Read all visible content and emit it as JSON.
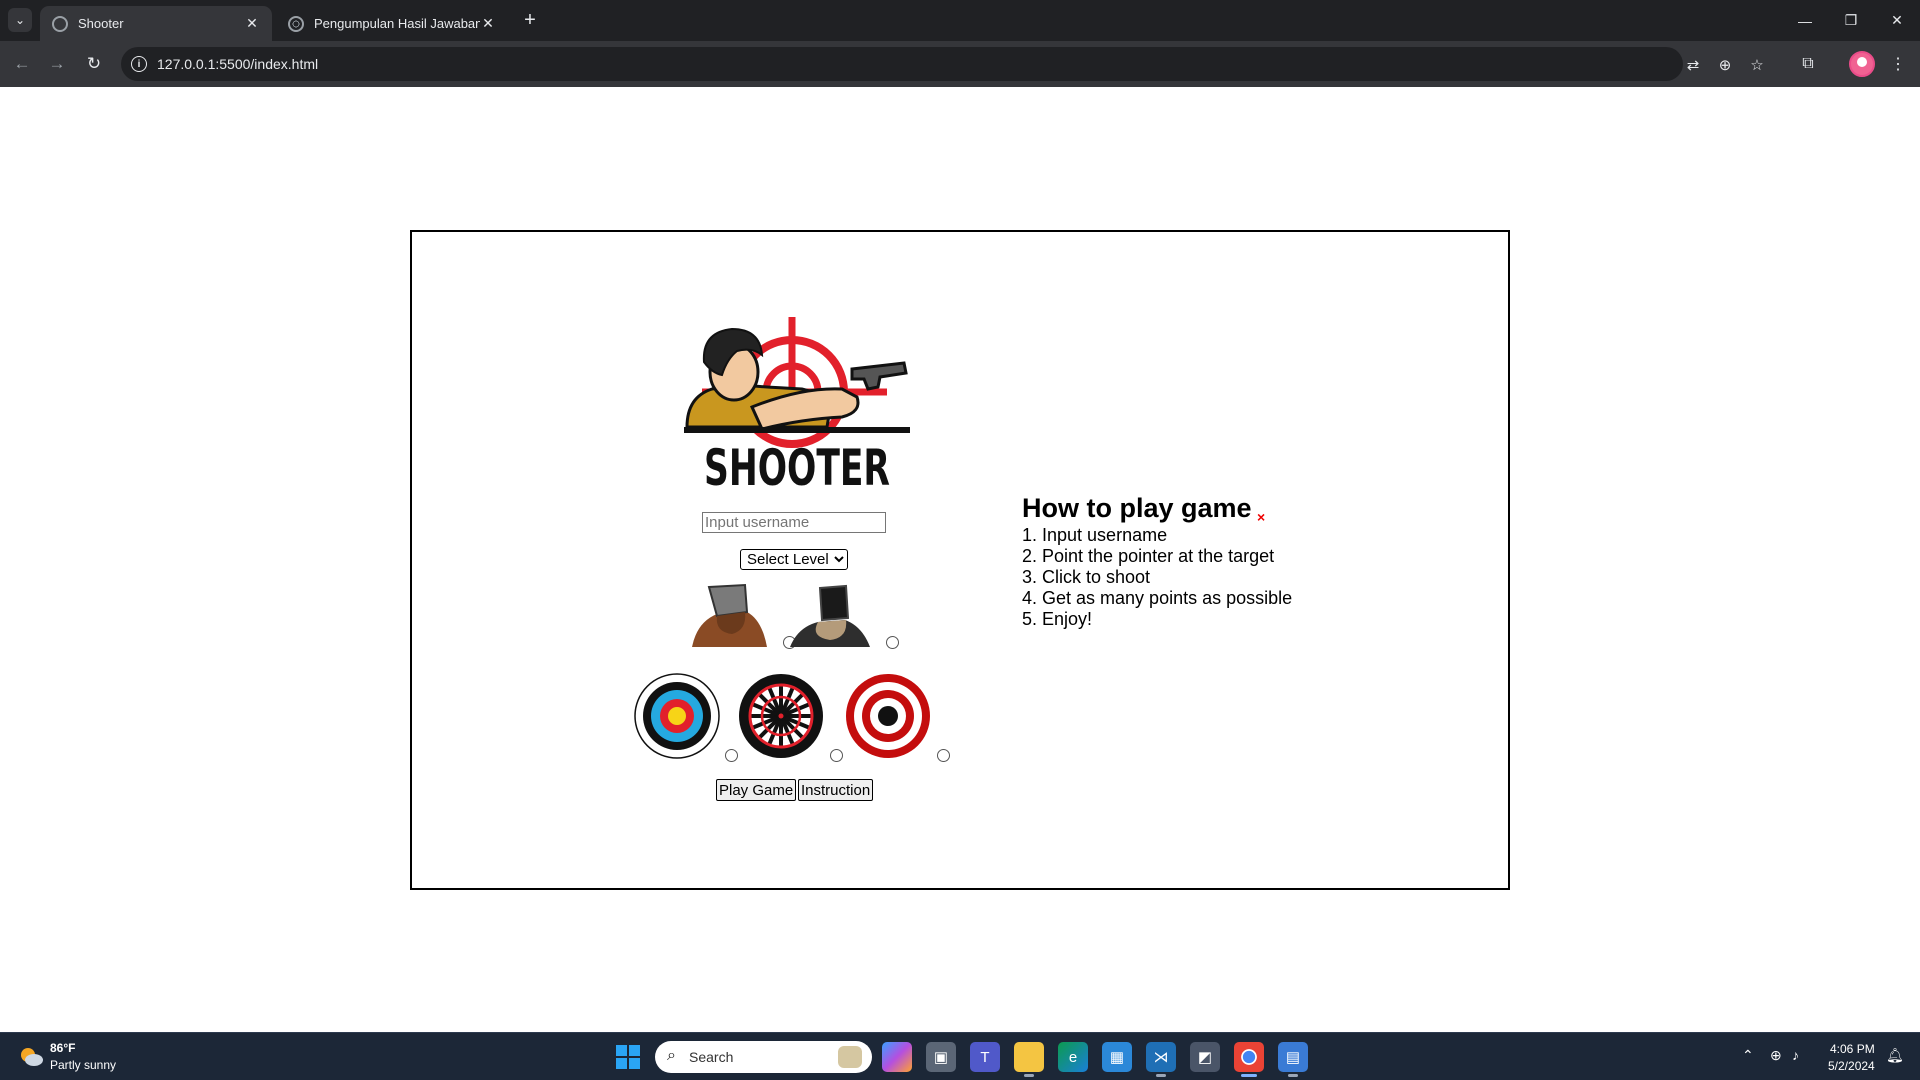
{
  "browser": {
    "tabs": [
      {
        "title": "Shooter",
        "active": true
      },
      {
        "title": "Pengumpulan Hasil Jawaban LK",
        "active": false
      }
    ],
    "new_tab_label": "+",
    "url": "127.0.0.1:5500/index.html"
  },
  "game": {
    "logo_text": "SHOOTER",
    "username_placeholder": "Input username",
    "level_select": {
      "selected": "Select Level"
    },
    "play_button": "Play Game",
    "instruction_button": "Instruction"
  },
  "instructions": {
    "title": "How to play game",
    "close_symbol": "×",
    "steps": [
      "1. Input username",
      "2. Point the pointer at the target",
      "3. Click to shoot",
      "4. Get as many points as possible",
      "5. Enjoy!"
    ]
  },
  "taskbar": {
    "weather_temp": "86°F",
    "weather_desc": "Partly sunny",
    "search_placeholder": "Search",
    "time": "4:06 PM",
    "date": "5/2/2024"
  },
  "colors": {
    "logo_red": "#e2202b",
    "target_red": "#c40d0d"
  }
}
